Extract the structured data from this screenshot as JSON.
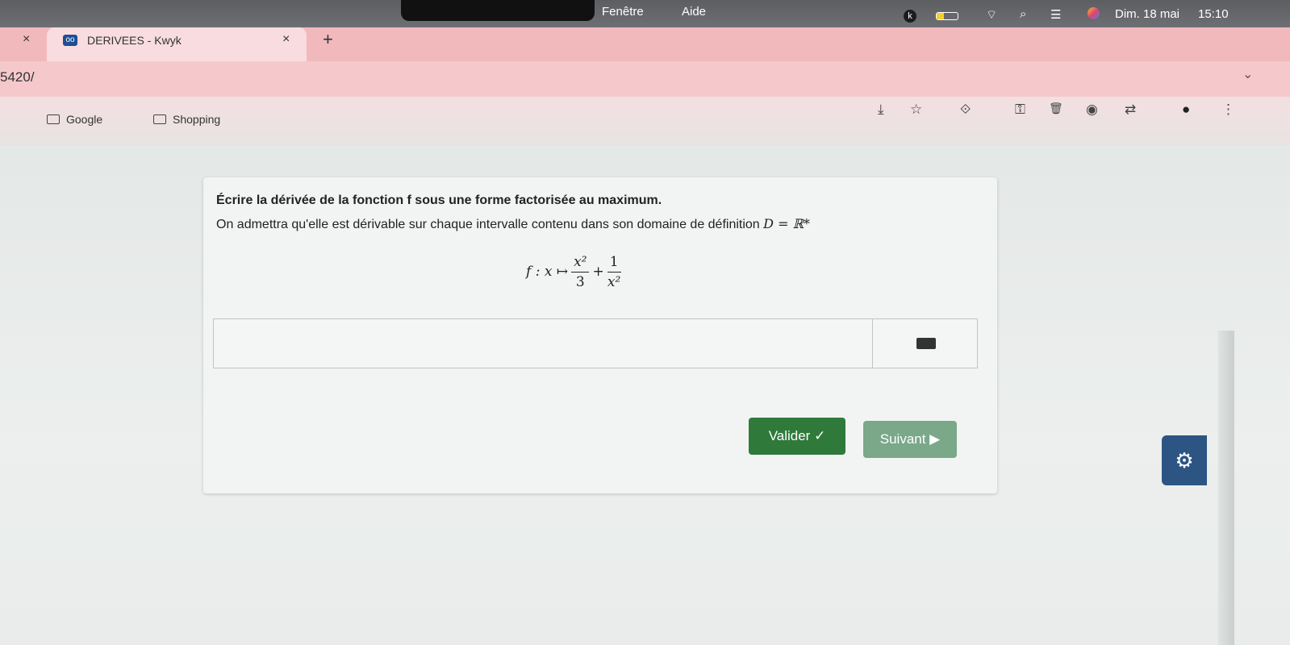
{
  "menubar": {
    "items": [
      "Fenêtre",
      "Aide"
    ],
    "clock_date": "Dim. 18 mai",
    "clock_time": "15:10",
    "k_badge": "k"
  },
  "browser": {
    "window_close": "×",
    "tab_favicon": "oo",
    "tab_title": "DERIVEES - Kwyk",
    "tab_close": "×",
    "new_tab": "+",
    "url": "5420/",
    "dropdown": "⌄",
    "bookmarks": [
      {
        "label": "Google"
      },
      {
        "label": "Shopping"
      }
    ],
    "icons": {
      "download": "⤓",
      "star": "☆",
      "extension": "⟐",
      "key": "⚿",
      "trash": "🗑",
      "camera": "◉",
      "translate": "⇄",
      "profile": "●",
      "more": "⋮"
    }
  },
  "exercise": {
    "instruction": "Écrire la dérivée de la fonction f sous une forme factorisée au maximum.",
    "note_prefix": "On admettra qu'elle est dérivable sur chaque intervalle contenu dans son domaine de définition ",
    "domain": "D = ℝ*",
    "formula": {
      "lhs": "f : x ↦",
      "frac1_num": "x²",
      "frac1_den": "3",
      "plus": "+",
      "frac2_num": "1",
      "frac2_den": "x²"
    },
    "answer_value": "",
    "validate_label": "Valider ✓",
    "next_label": "Suivant ▶"
  },
  "help_widget_icon": "⚙",
  "colors": {
    "validate": "#2f7a3a",
    "next": "#7aa889",
    "tabstrip": "#f2b9bd"
  }
}
